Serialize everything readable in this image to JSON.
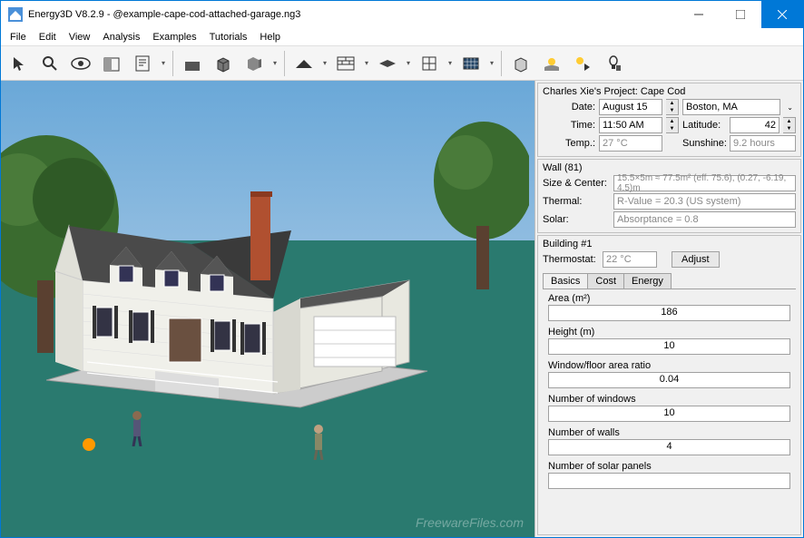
{
  "window": {
    "title": "Energy3D V8.2.9 - @example-cape-cod-attached-garage.ng3"
  },
  "menu": {
    "items": [
      "File",
      "Edit",
      "View",
      "Analysis",
      "Examples",
      "Tutorials",
      "Help"
    ]
  },
  "project": {
    "header": "Charles Xie's  Project: Cape Cod",
    "date_label": "Date:",
    "date": "August 15",
    "location": "Boston, MA",
    "time_label": "Time:",
    "time": "11:50 AM",
    "latitude_label": "Latitude:",
    "latitude": "42",
    "temp_label": "Temp.:",
    "temp": "27 °C",
    "sunshine_label": "Sunshine:",
    "sunshine": "9.2 hours"
  },
  "wall": {
    "header": "Wall (81)",
    "size_label": "Size & Center:",
    "size": "15.5×5m ≈ 77.5m² (eff. 75.6), (0.27, -6.19, 4.5)m",
    "thermal_label": "Thermal:",
    "thermal": "R-Value = 20.3 (US system)",
    "solar_label": "Solar:",
    "solar": "Absorptance = 0.8"
  },
  "building": {
    "header": "Building #1",
    "thermostat_label": "Thermostat:",
    "thermostat": "22 °C",
    "adjust": "Adjust"
  },
  "tabs": {
    "basics": "Basics",
    "cost": "Cost",
    "energy": "Energy"
  },
  "basics": {
    "area_label": "Area (m²)",
    "area": "186",
    "height_label": "Height (m)",
    "height": "10",
    "wfr_label": "Window/floor area ratio",
    "wfr": "0.04",
    "windows_label": "Number of windows",
    "windows": "10",
    "walls_label": "Number of walls",
    "walls": "4",
    "solar_panels_label": "Number of solar panels",
    "solar_panels": ""
  },
  "watermark": "FreewareFiles.com"
}
